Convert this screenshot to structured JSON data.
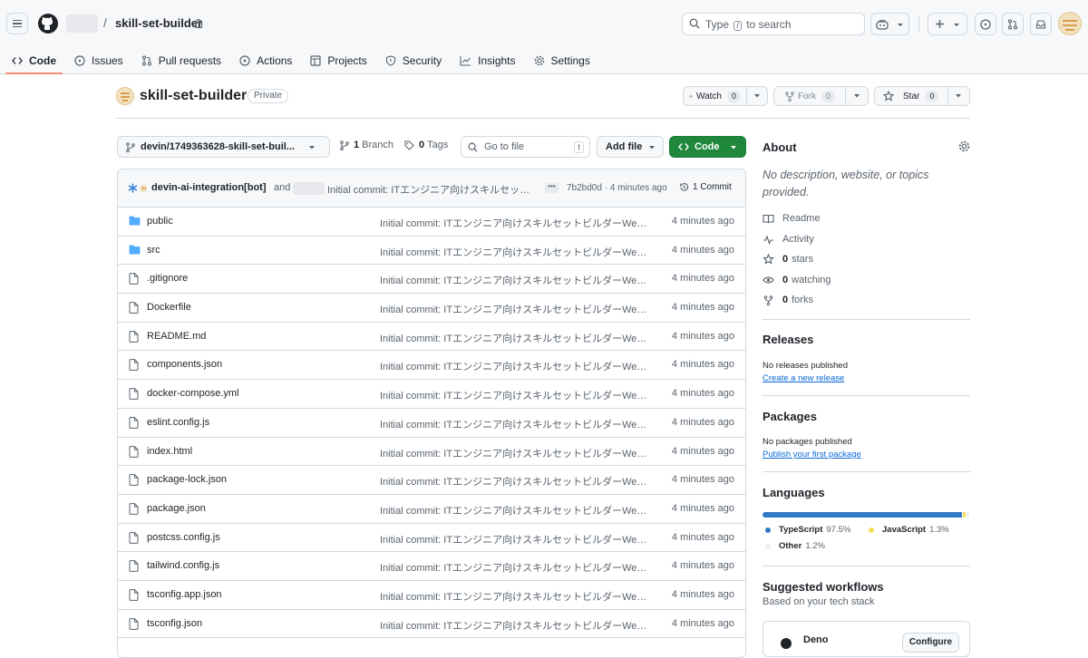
{
  "header": {
    "repo_name": "skill-set-builder",
    "breadcrumb_sep": "/",
    "search_prefix": "Type",
    "search_key": "/",
    "search_suffix": "to search"
  },
  "tabs": [
    {
      "label": "Code",
      "icon": "code-icon"
    },
    {
      "label": "Issues",
      "icon": "issue-icon"
    },
    {
      "label": "Pull requests",
      "icon": "pull-request-icon"
    },
    {
      "label": "Actions",
      "icon": "play-icon"
    },
    {
      "label": "Projects",
      "icon": "table-icon"
    },
    {
      "label": "Security",
      "icon": "shield-icon"
    },
    {
      "label": "Insights",
      "icon": "graph-icon"
    },
    {
      "label": "Settings",
      "icon": "gear-icon"
    }
  ],
  "repo": {
    "title": "skill-set-builder",
    "visibility": "Private",
    "watch_label": "Watch",
    "watch_count": "0",
    "fork_label": "Fork",
    "fork_count": "0",
    "star_label": "Star",
    "star_count": "0"
  },
  "toolbar": {
    "branch": "devin/1749363628-skill-set-buil...",
    "branch_count": "1",
    "branch_label": "Branch",
    "tag_count": "0",
    "tag_label": "Tags",
    "goto_placeholder": "Go to file",
    "goto_key": "t",
    "add_file": "Add file",
    "code_button": "Code"
  },
  "latest_commit": {
    "author": "devin-ai-integration[bot]",
    "and": "and",
    "message": "Initial commit: ITエンジニア向けスキルセットビルダーWeb...",
    "ellipsis": "•••",
    "sha": "7b2bd0d",
    "time": "4 minutes ago",
    "commits_count": "1 Commit"
  },
  "files": [
    {
      "name": "public",
      "type": "dir",
      "message": "Initial commit: ITエンジニア向けスキルセットビルダーWeb...",
      "time": "4 minutes ago"
    },
    {
      "name": "src",
      "type": "dir",
      "message": "Initial commit: ITエンジニア向けスキルセットビルダーWeb...",
      "time": "4 minutes ago"
    },
    {
      "name": ".gitignore",
      "type": "file",
      "message": "Initial commit: ITエンジニア向けスキルセットビルダーWeb...",
      "time": "4 minutes ago"
    },
    {
      "name": "Dockerfile",
      "type": "file",
      "message": "Initial commit: ITエンジニア向けスキルセットビルダーWeb...",
      "time": "4 minutes ago"
    },
    {
      "name": "README.md",
      "type": "file",
      "message": "Initial commit: ITエンジニア向けスキルセットビルダーWeb...",
      "time": "4 minutes ago"
    },
    {
      "name": "components.json",
      "type": "file",
      "message": "Initial commit: ITエンジニア向けスキルセットビルダーWeb...",
      "time": "4 minutes ago"
    },
    {
      "name": "docker-compose.yml",
      "type": "file",
      "message": "Initial commit: ITエンジニア向けスキルセットビルダーWeb...",
      "time": "4 minutes ago"
    },
    {
      "name": "eslint.config.js",
      "type": "file",
      "message": "Initial commit: ITエンジニア向けスキルセットビルダーWeb...",
      "time": "4 minutes ago"
    },
    {
      "name": "index.html",
      "type": "file",
      "message": "Initial commit: ITエンジニア向けスキルセットビルダーWeb...",
      "time": "4 minutes ago"
    },
    {
      "name": "package-lock.json",
      "type": "file",
      "message": "Initial commit: ITエンジニア向けスキルセットビルダーWeb...",
      "time": "4 minutes ago"
    },
    {
      "name": "package.json",
      "type": "file",
      "message": "Initial commit: ITエンジニア向けスキルセットビルダーWeb...",
      "time": "4 minutes ago"
    },
    {
      "name": "postcss.config.js",
      "type": "file",
      "message": "Initial commit: ITエンジニア向けスキルセットビルダーWeb...",
      "time": "4 minutes ago"
    },
    {
      "name": "tailwind.config.js",
      "type": "file",
      "message": "Initial commit: ITエンジニア向けスキルセットビルダーWeb...",
      "time": "4 minutes ago"
    },
    {
      "name": "tsconfig.app.json",
      "type": "file",
      "message": "Initial commit: ITエンジニア向けスキルセットビルダーWeb...",
      "time": "4 minutes ago"
    },
    {
      "name": "tsconfig.json",
      "type": "file",
      "message": "Initial commit: ITエンジニア向けスキルセットビルダーWeb...",
      "time": "4 minutes ago"
    }
  ],
  "sidebar": {
    "about_title": "About",
    "about_desc": "No description, website, or topics provided.",
    "readme": "Readme",
    "activity": "Activity",
    "stars_count": "0",
    "stars_label": "stars",
    "watching_count": "0",
    "watching_label": "watching",
    "forks_count": "0",
    "forks_label": "forks",
    "releases_title": "Releases",
    "releases_none": "No releases published",
    "releases_link": "Create a new release",
    "packages_title": "Packages",
    "packages_none": "No packages published",
    "packages_link": "Publish your first package",
    "languages_title": "Languages",
    "languages": [
      {
        "name": "TypeScript",
        "percent": "97.5%",
        "value": 97.5,
        "color": "#3178c6"
      },
      {
        "name": "JavaScript",
        "percent": "1.3%",
        "value": 1.3,
        "color": "#f1e05a"
      },
      {
        "name": "Other",
        "percent": "1.2%",
        "value": 1.2,
        "color": "#ededed"
      }
    ],
    "workflows_title": "Suggested workflows",
    "workflows_sub": "Based on your tech stack",
    "workflow_name": "Deno",
    "workflow_button": "Configure"
  },
  "colors": {
    "accent_tab": "#fd8c73",
    "code_button": "#1f883d",
    "link": "#0969da"
  }
}
